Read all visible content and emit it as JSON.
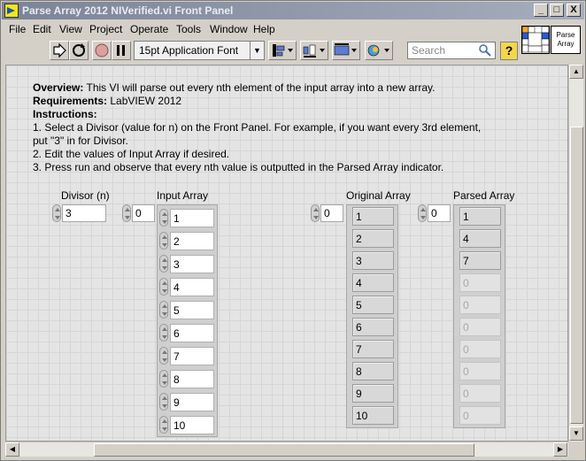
{
  "window": {
    "title": "Parse Array 2012 NIVerified.vi Front Panel",
    "minimize": "_",
    "maximize": "□",
    "close": "X"
  },
  "menu": [
    "File",
    "Edit",
    "View",
    "Project",
    "Operate",
    "Tools",
    "Window",
    "Help"
  ],
  "toolbar": {
    "font": "15pt Application Font",
    "search_placeholder": "Search",
    "help": "?",
    "vi_icon_text_1": "Parse",
    "vi_icon_text_2": "Array"
  },
  "overview": {
    "overview_label": "Overview:",
    "overview_text": " This VI will parse out every nth element of the input array into a new array.",
    "requirements_label": "Requirements:",
    "requirements_text": " LabVIEW 2012",
    "instructions_label": "Instructions:",
    "steps": [
      "1. Select a Divisor (value for n) on the Front Panel. For example, if you want every 3rd element,",
      "put \"3\" in for Divisor.",
      "2. Edit the values of Input Array if desired.",
      "3. Press run and observe that every nth value is outputted in the Parsed Array indicator."
    ]
  },
  "divisor": {
    "label": "Divisor (n)",
    "value": "3"
  },
  "input_array": {
    "label": "Input Array",
    "index": "0",
    "values": [
      "1",
      "2",
      "3",
      "4",
      "5",
      "6",
      "7",
      "8",
      "9",
      "10"
    ]
  },
  "original_array": {
    "label": "Original Array",
    "index": "0",
    "values": [
      "1",
      "2",
      "3",
      "4",
      "5",
      "6",
      "7",
      "8",
      "9",
      "10"
    ]
  },
  "parsed_array": {
    "label": "Parsed Array",
    "index": "0",
    "values": [
      "1",
      "4",
      "7",
      "0",
      "0",
      "0",
      "0",
      "0",
      "0",
      "0"
    ],
    "valid_count": 3
  }
}
